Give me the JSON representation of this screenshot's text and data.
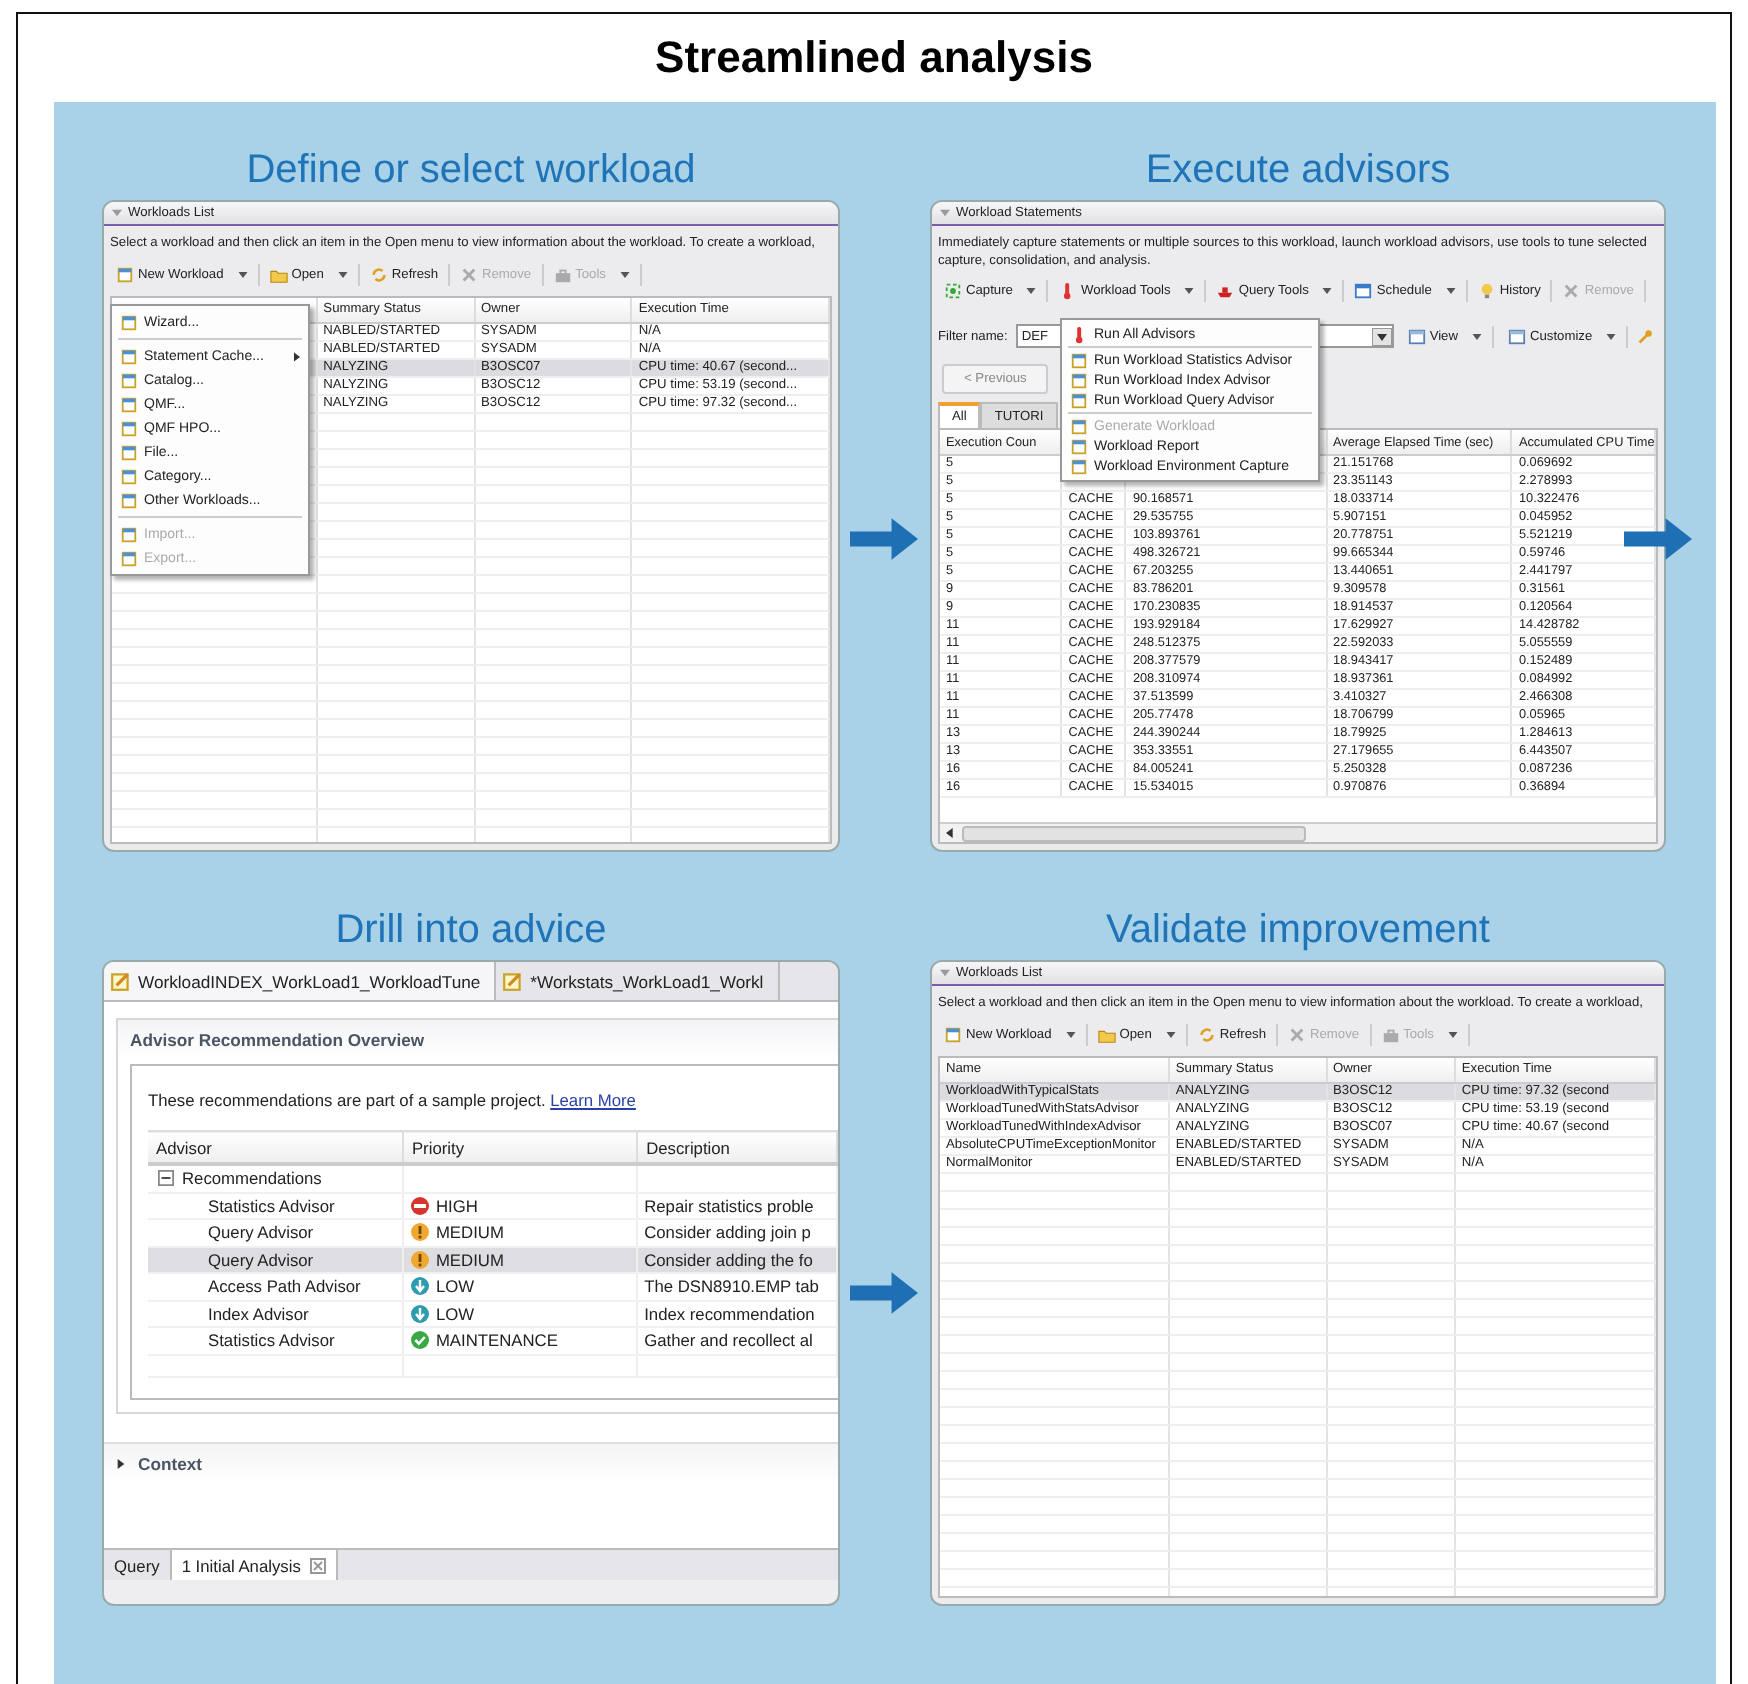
{
  "title": "Streamlined analysis",
  "define_panel": {
    "caption": "Define or select workload",
    "view_title": "Workloads List",
    "instructions": "Select a workload and then click an item in the Open menu to view information about the workload.  To create a workload,",
    "toolbar": [
      {
        "label": "New Workload",
        "dropdown": true,
        "disabled": false
      },
      {
        "label": "Open",
        "dropdown": true,
        "disabled": false
      },
      {
        "label": "Refresh",
        "dropdown": false,
        "disabled": false
      },
      {
        "label": "Remove",
        "dropdown": false,
        "disabled": true
      },
      {
        "label": "Tools",
        "dropdown": true,
        "disabled": true
      }
    ],
    "columns": [
      "Summary Status",
      "Owner",
      "Execution Time"
    ],
    "rows": [
      {
        "status": "NABLED/STARTED",
        "owner": "SYSADM",
        "time": "N/A",
        "selected": false
      },
      {
        "status": "NABLED/STARTED",
        "owner": "SYSADM",
        "time": "N/A",
        "selected": false
      },
      {
        "status": "NALYZING",
        "owner": "B3OSC07",
        "time": "CPU time: 40.67 (second...",
        "selected": true
      },
      {
        "status": "NALYZING",
        "owner": "B3OSC12",
        "time": "CPU time: 53.19 (second...",
        "selected": false
      },
      {
        "status": "NALYZING",
        "owner": "B3OSC12",
        "time": "CPU time: 97.32 (second...",
        "selected": false
      }
    ],
    "menu": [
      [
        {
          "label": "Wizard...",
          "disabled": false,
          "submenu": false
        }
      ],
      [
        {
          "label": "Statement Cache...",
          "disabled": false,
          "submenu": true
        },
        {
          "label": "Catalog...",
          "disabled": false,
          "submenu": false
        },
        {
          "label": "QMF...",
          "disabled": false,
          "submenu": false
        },
        {
          "label": "QMF HPO...",
          "disabled": false,
          "submenu": false
        },
        {
          "label": "File...",
          "disabled": false,
          "submenu": false
        },
        {
          "label": "Category...",
          "disabled": false,
          "submenu": false
        },
        {
          "label": "Other Workloads...",
          "disabled": false,
          "submenu": false
        }
      ],
      [
        {
          "label": "Import...",
          "disabled": true,
          "submenu": false
        },
        {
          "label": "Export...",
          "disabled": true,
          "submenu": false
        }
      ]
    ]
  },
  "execute_panel": {
    "caption": "Execute advisors",
    "view_title": "Workload Statements",
    "description": "Immediately capture statements or multiple sources to this workload, launch workload advisors, use tools to tune selected capture, consolidation, and analysis.",
    "toolbar": [
      {
        "label": "Capture",
        "dropdown": true,
        "disabled": false
      },
      {
        "label": "Workload Tools",
        "dropdown": true,
        "disabled": false
      },
      {
        "label": "Query Tools",
        "dropdown": true,
        "disabled": false
      },
      {
        "label": "Schedule",
        "dropdown": true,
        "disabled": false
      },
      {
        "label": "History",
        "dropdown": false,
        "disabled": false
      },
      {
        "label": "Remove",
        "dropdown": false,
        "disabled": true
      }
    ],
    "filter_label": "Filter name:",
    "filter_value": "DEF",
    "view_buttons": [
      {
        "label": "View"
      },
      {
        "label": "Customize"
      }
    ],
    "previous_button": "< Previous",
    "tabs": [
      {
        "label": "All",
        "selected": true
      },
      {
        "label": "TUTORI",
        "selected": false
      }
    ],
    "columns": [
      "Execution Coun",
      "Average Elapsed Time (sec)",
      "Accumulated CPU Time"
    ],
    "rows": [
      {
        "count": "5",
        "avg": "21.151768",
        "cpu": "0.069692"
      },
      {
        "count": "5",
        "avg": "23.351143",
        "cpu": "2.278993"
      },
      {
        "count": "5",
        "source": "CACHE",
        "column_3": "90.168571",
        "avg": "18.033714",
        "cpu": "10.322476"
      },
      {
        "count": "5",
        "source": "CACHE",
        "column_3": "29.535755",
        "avg": "5.907151",
        "cpu": "0.045952"
      },
      {
        "count": "5",
        "source": "CACHE",
        "column_3": "103.893761",
        "avg": "20.778751",
        "cpu": "5.521219"
      },
      {
        "count": "5",
        "source": "CACHE",
        "column_3": "498.326721",
        "avg": "99.665344",
        "cpu": "0.59746"
      },
      {
        "count": "5",
        "source": "CACHE",
        "column_3": "67.203255",
        "avg": "13.440651",
        "cpu": "2.441797"
      },
      {
        "count": "9",
        "source": "CACHE",
        "column_3": "83.786201",
        "avg": "9.309578",
        "cpu": "0.31561"
      },
      {
        "count": "9",
        "source": "CACHE",
        "column_3": "170.230835",
        "avg": "18.914537",
        "cpu": "0.120564"
      },
      {
        "count": "11",
        "source": "CACHE",
        "column_3": "193.929184",
        "avg": "17.629927",
        "cpu": "14.428782"
      },
      {
        "count": "11",
        "source": "CACHE",
        "column_3": "248.512375",
        "avg": "22.592033",
        "cpu": "5.055559"
      },
      {
        "count": "11",
        "source": "CACHE",
        "column_3": "208.377579",
        "avg": "18.943417",
        "cpu": "0.152489"
      },
      {
        "count": "11",
        "source": "CACHE",
        "column_3": "208.310974",
        "avg": "18.937361",
        "cpu": "0.084992"
      },
      {
        "count": "11",
        "source": "CACHE",
        "column_3": "37.513599",
        "avg": "3.410327",
        "cpu": "2.466308"
      },
      {
        "count": "11",
        "source": "CACHE",
        "column_3": "205.77478",
        "avg": "18.706799",
        "cpu": "0.05965"
      },
      {
        "count": "13",
        "source": "CACHE",
        "column_3": "244.390244",
        "avg": "18.79925",
        "cpu": "1.284613"
      },
      {
        "count": "13",
        "source": "CACHE",
        "column_3": "353.33551",
        "avg": "27.179655",
        "cpu": "6.443507"
      },
      {
        "count": "16",
        "source": "CACHE",
        "column_3": "84.005241",
        "avg": "5.250328",
        "cpu": "0.087236"
      },
      {
        "count": "16",
        "source": "CACHE",
        "column_3": "15.534015",
        "avg": "0.970876",
        "cpu": "0.36894"
      }
    ],
    "menu": [
      [
        {
          "label": "Run All Advisors",
          "disabled": false
        }
      ],
      [
        {
          "label": "Run Workload Statistics Advisor",
          "disabled": false
        },
        {
          "label": "Run Workload Index Advisor",
          "disabled": false
        },
        {
          "label": "Run Workload Query Advisor",
          "disabled": false
        }
      ],
      [
        {
          "label": "Generate Workload",
          "disabled": true
        },
        {
          "label": "Workload Report",
          "disabled": false
        },
        {
          "label": "Workload Environment Capture",
          "disabled": false
        }
      ]
    ]
  },
  "drill_panel": {
    "caption": "Drill into advice",
    "editor_tabs": [
      {
        "label": "WorkloadINDEX_WorkLoad1_WorkloadTune",
        "selected": true
      },
      {
        "label": "*Workstats_WorkLoad1_Workl",
        "selected": false
      }
    ],
    "section_title": "Advisor Recommendation Overview",
    "note": "These recommendations are part of a sample project.",
    "link": "Learn More",
    "columns": [
      "Advisor",
      "Priority",
      "Description"
    ],
    "tree": {
      "label": "Recommendations",
      "expanded": true,
      "children": [
        {
          "advisor": "Statistics Advisor",
          "priority": "HIGH",
          "kind": "high",
          "description": "Repair statistics proble",
          "selected": false
        },
        {
          "advisor": "Query Advisor",
          "priority": "MEDIUM",
          "kind": "medium",
          "description": "Consider adding join p",
          "selected": false
        },
        {
          "advisor": "Query Advisor",
          "priority": "MEDIUM",
          "kind": "medium",
          "description": "Consider adding the fo",
          "selected": true
        },
        {
          "advisor": "Access Path Advisor",
          "priority": "LOW",
          "kind": "low",
          "description": "The DSN8910.EMP tab",
          "selected": false
        },
        {
          "advisor": "Index Advisor",
          "priority": "LOW",
          "kind": "low",
          "description": "Index recommendation",
          "selected": false
        },
        {
          "advisor": "Statistics Advisor",
          "priority": "MAINTENANCE",
          "kind": "maintenance",
          "description": "Gather and recollect al",
          "selected": false
        }
      ]
    },
    "context": {
      "label": "Context",
      "expanded": false
    },
    "bottom_tabs": [
      {
        "label": "Query",
        "selected": false
      },
      {
        "label": "1 Initial Analysis",
        "selected": true
      }
    ]
  },
  "validate_panel": {
    "caption": "Validate improvement",
    "view_title": "Workloads List",
    "instructions": "Select a workload and then click an item in the Open menu to view information about the workload.  To create a workload,",
    "toolbar": [
      {
        "label": "New Workload",
        "dropdown": true,
        "disabled": false
      },
      {
        "label": "Open",
        "dropdown": true,
        "disabled": false
      },
      {
        "label": "Refresh",
        "dropdown": false,
        "disabled": false
      },
      {
        "label": "Remove",
        "dropdown": false,
        "disabled": true
      },
      {
        "label": "Tools",
        "dropdown": true,
        "disabled": true
      }
    ],
    "columns": [
      "Name",
      "Summary Status",
      "Owner",
      "Execution Time"
    ],
    "rows": [
      {
        "name": "WorkloadWithTypicalStats",
        "status": "ANALYZING",
        "owner": "B3OSC12",
        "time": "CPU time: 97.32 (second",
        "selected": true
      },
      {
        "name": "WorkloadTunedWithStatsAdvisor",
        "status": "ANALYZING",
        "owner": "B3OSC12",
        "time": "CPU time: 53.19 (second",
        "selected": false
      },
      {
        "name": "WorkloadTunedWithIndexAdvisor",
        "status": "ANALYZING",
        "owner": "B3OSC07",
        "time": "CPU time: 40.67 (second",
        "selected": false
      },
      {
        "name": "AbsoluteCPUTimeExceptionMonitor",
        "status": "ENABLED/STARTED",
        "owner": "SYSADM",
        "time": "N/A",
        "selected": false
      },
      {
        "name": "NormalMonitor",
        "status": "ENABLED/STARTED",
        "owner": "SYSADM",
        "time": "N/A",
        "selected": false
      }
    ]
  }
}
